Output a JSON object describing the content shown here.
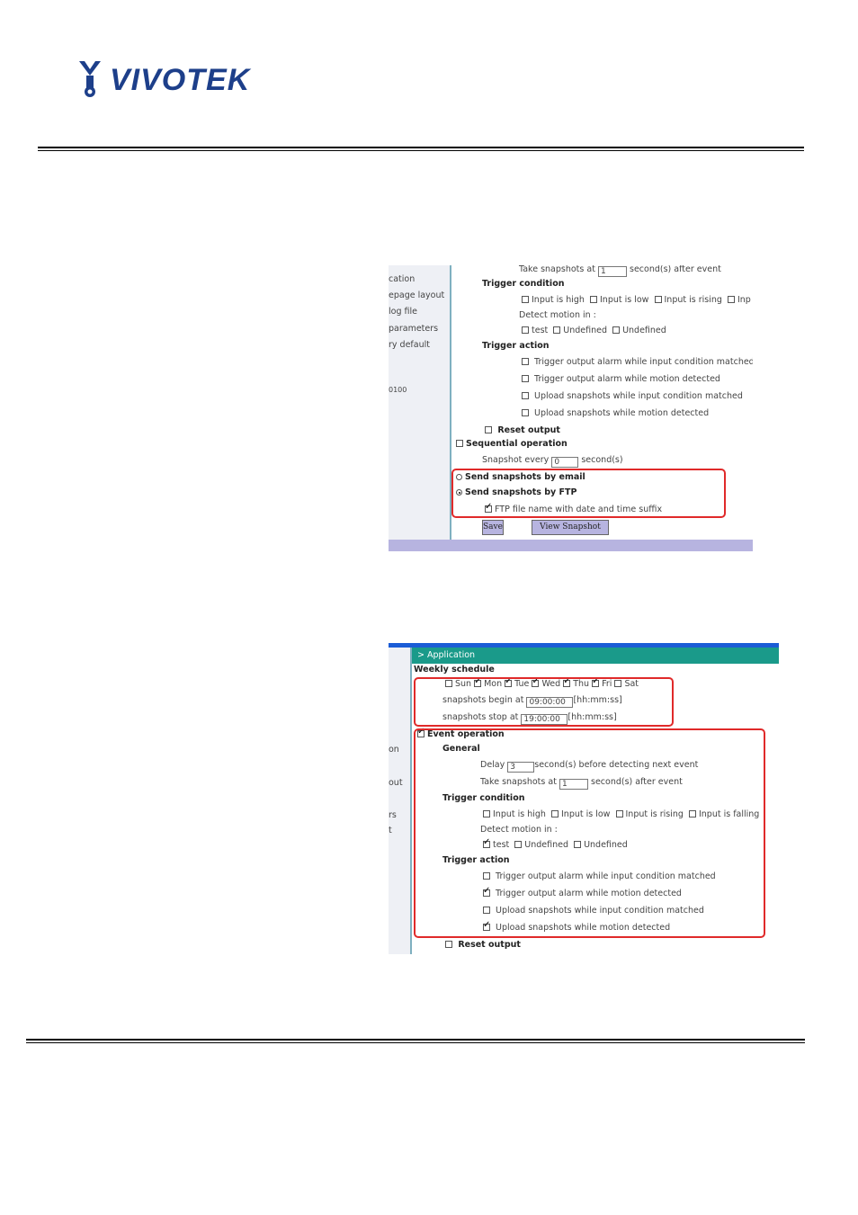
{
  "brand": {
    "name": "VIVOTEK"
  },
  "colors": {
    "logo": "#1d3f8a",
    "highlight": "#e02a2a",
    "title_bar": "#1a9a8a",
    "footer_bar": "#b7b4e0"
  },
  "screenshot1": {
    "sidebar": [
      "cation",
      "epage layout",
      "log file",
      "parameters",
      "ry default",
      "0100"
    ],
    "take_snapshots": {
      "prefix": "Take snapshots at",
      "value": "1",
      "suffix": "second(s) after event"
    },
    "trigger_condition": {
      "title": "Trigger condition",
      "inputs": [
        "Input is high",
        "Input is low",
        "Input is rising",
        "Inp"
      ],
      "detect_label": "Detect motion in :",
      "windows": [
        "test",
        "Undefined",
        "Undefined"
      ]
    },
    "trigger_action": {
      "title": "Trigger action",
      "items": [
        "Trigger output alarm while input condition matched",
        "Trigger output alarm while motion detected",
        "Upload snapshots while input condition matched",
        "Upload snapshots while motion detected"
      ]
    },
    "reset_output": "Reset output",
    "sequential": "Sequential operation",
    "snapshot_every": {
      "prefix": "Snapshot every",
      "value": "0",
      "suffix": "second(s)"
    },
    "send_email": "Send snapshots by email",
    "send_ftp": "Send snapshots by FTP",
    "ftp_suffix": "FTP file name with date and time suffix",
    "save_button": "Save",
    "view_button": "View Snapshot"
  },
  "screenshot2": {
    "sidebar": [
      "on",
      "out",
      "rs",
      "t"
    ],
    "title": "> Application",
    "weekly_schedule": "Weekly schedule",
    "days": [
      {
        "label": "Sun",
        "checked": false
      },
      {
        "label": "Mon",
        "checked": true
      },
      {
        "label": "Tue",
        "checked": true
      },
      {
        "label": "Wed",
        "checked": true
      },
      {
        "label": "Thu",
        "checked": true
      },
      {
        "label": "Fri",
        "checked": true
      },
      {
        "label": "Sat",
        "checked": false
      }
    ],
    "begin": {
      "prefix": "snapshots begin at",
      "value": "09:00:00",
      "suffix": "[hh:mm:ss]"
    },
    "stop": {
      "prefix": "snapshots stop at",
      "value": "19:00:00",
      "suffix": "[hh:mm:ss]"
    },
    "event_operation": "Event operation",
    "general": "General",
    "delay": {
      "prefix": "Delay",
      "value": "3",
      "suffix": "second(s) before detecting next event"
    },
    "take_snapshots": {
      "prefix": "Take snapshots at",
      "value": "1",
      "suffix": "second(s) after event"
    },
    "trigger_condition": {
      "title": "Trigger condition",
      "inputs": [
        "Input is high",
        "Input is low",
        "Input is rising",
        "Input is falling"
      ],
      "detect_label": "Detect motion in :",
      "windows": [
        "test",
        "Undefined",
        "Undefined"
      ]
    },
    "trigger_action": {
      "title": "Trigger action",
      "items": [
        "Trigger output alarm while input condition matched",
        "Trigger output alarm while motion detected",
        "Upload snapshots while input condition matched",
        "Upload snapshots while motion detected"
      ]
    },
    "reset_output": "Reset output"
  }
}
